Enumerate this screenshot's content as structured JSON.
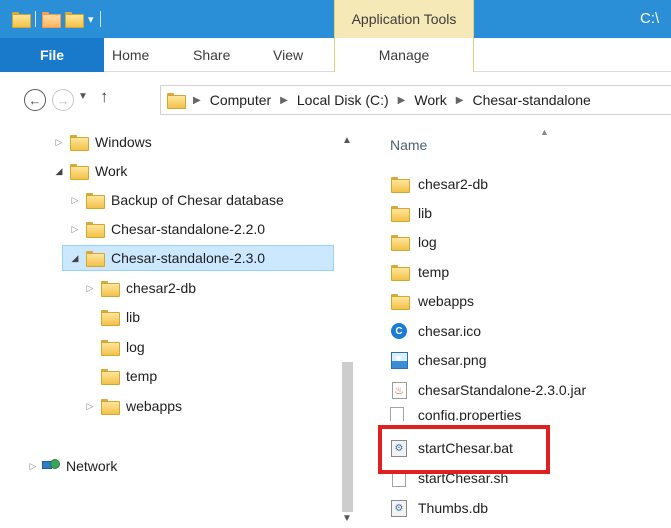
{
  "titlebar": {
    "app_tools_label": "Application Tools",
    "window_title": "C:\\"
  },
  "ribbon": {
    "tabs": [
      {
        "label": "File"
      },
      {
        "label": "Home"
      },
      {
        "label": "Share"
      },
      {
        "label": "View"
      },
      {
        "label": "Manage"
      }
    ]
  },
  "address": {
    "crumbs": [
      "Computer",
      "Local Disk (C:)",
      "Work",
      "Chesar-standalone"
    ]
  },
  "nav_tree": {
    "items": [
      {
        "label": "Windows"
      },
      {
        "label": "Work"
      },
      {
        "label": "Backup of Chesar database"
      },
      {
        "label": "Chesar-standalone-2.2.0"
      },
      {
        "label": "Chesar-standalone-2.3.0"
      },
      {
        "label": "chesar2-db"
      },
      {
        "label": "lib"
      },
      {
        "label": "log"
      },
      {
        "label": "temp"
      },
      {
        "label": "webapps"
      },
      {
        "label": "Network"
      }
    ]
  },
  "content": {
    "column_name": "Name",
    "files": [
      {
        "name": "chesar2-db",
        "icon": "folder-icon"
      },
      {
        "name": "lib",
        "icon": "folder-icon"
      },
      {
        "name": "log",
        "icon": "folder-icon"
      },
      {
        "name": "temp",
        "icon": "folder-icon"
      },
      {
        "name": "webapps",
        "icon": "folder-icon"
      },
      {
        "name": "chesar.ico",
        "icon": "ico-file-icon"
      },
      {
        "name": "chesar.png",
        "icon": "image-file-icon"
      },
      {
        "name": "chesarStandalone-2.3.0.jar",
        "icon": "java-jar-icon"
      },
      {
        "name": "config.properties",
        "icon": "document-icon"
      },
      {
        "name": "startChesar.bat",
        "icon": "batch-file-icon"
      },
      {
        "name": "startChesar.sh",
        "icon": "document-icon"
      },
      {
        "name": "Thumbs.db",
        "icon": "database-file-icon"
      }
    ]
  },
  "colors": {
    "titlebar": "#2b8fd8",
    "file_tab": "#1979ca",
    "app_tools": "#f6e9b8",
    "selection": "#cce8ff",
    "highlight": "#e02020"
  }
}
